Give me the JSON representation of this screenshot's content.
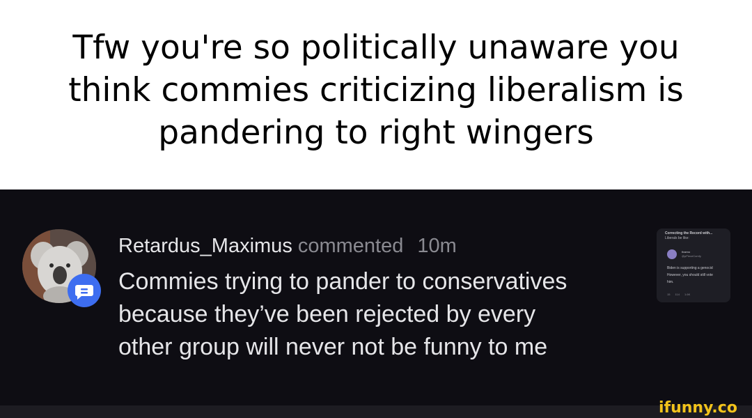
{
  "caption": {
    "lines": [
      "Tfw you're so politically unaware you",
      "think commies criticizing liberalism is",
      "pandering to right wingers"
    ]
  },
  "comment": {
    "username": "Retardus_Maximus",
    "action": "commented",
    "time": "10m",
    "body_lines": [
      "Commies trying to pander to conservatives",
      "because they’ve been rejected by every",
      "other group will never not be funny to me"
    ]
  },
  "thumbnail": {
    "title": "Correcting the Record with...",
    "subtitle": "Liberals be like:",
    "name": "thaeno",
    "handle": "@pPieceComfy",
    "text_lines": [
      "Biden is supporting a genocid",
      "However, you should still vote",
      "him."
    ],
    "stats": "15 114 1.6K"
  },
  "watermark": {
    "text": "ifunny.co"
  },
  "colors": {
    "caption_bg": "#ffffff",
    "screenshot_bg": "#0e0d13",
    "badge_blue": "#3d6df0",
    "watermark_yellow": "#f2c31b"
  },
  "icons": [
    "comment-bubble-icon",
    "chevron-left-icon"
  ]
}
